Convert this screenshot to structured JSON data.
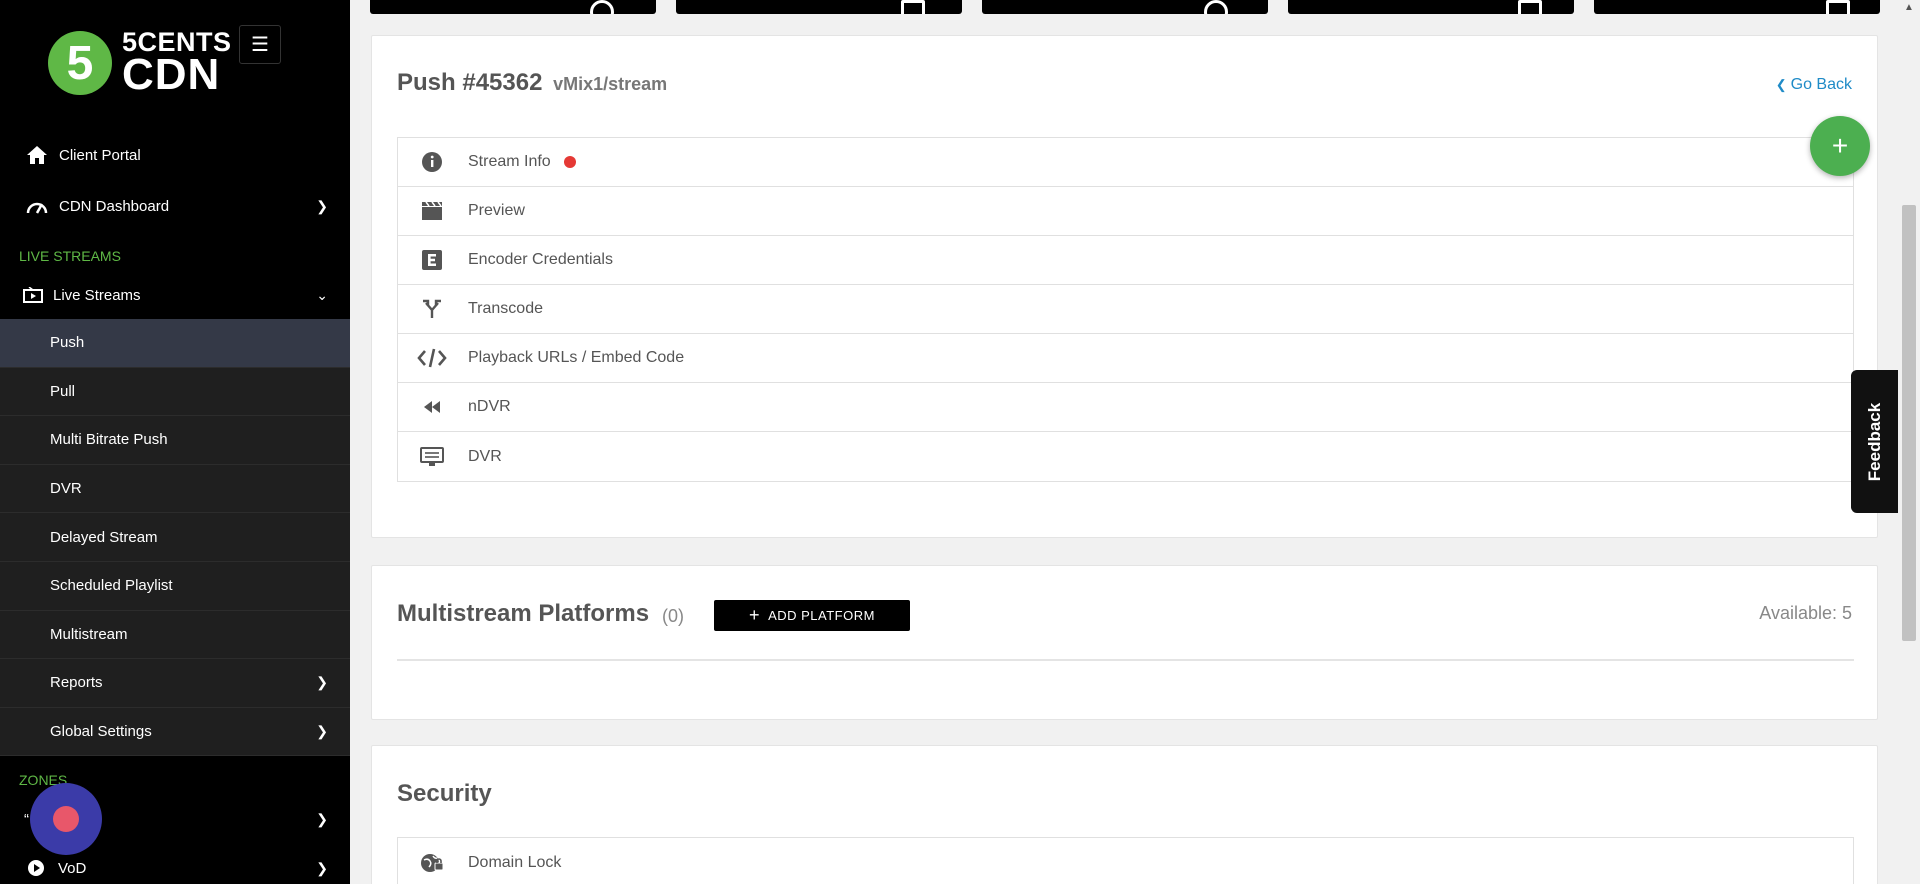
{
  "brand": {
    "logo_mark": "5",
    "logo_line1": "5CENTS",
    "logo_line2": "CDN",
    "accent_color": "#5fb846"
  },
  "sidebar": {
    "menu_icon": "hamburger-icon",
    "top_items": [
      {
        "label": "Client Portal",
        "icon": "home-icon"
      },
      {
        "label": "CDN Dashboard",
        "icon": "speedometer-icon"
      }
    ],
    "section_live": "LIVE STREAMS",
    "live_streams_label": "Live Streams",
    "sub_items": [
      {
        "label": "Push",
        "active": true
      },
      {
        "label": "Pull"
      },
      {
        "label": "Multi Bitrate Push"
      },
      {
        "label": "DVR"
      },
      {
        "label": "Delayed Stream"
      },
      {
        "label": "Scheduled Playlist"
      },
      {
        "label": "Multistream"
      },
      {
        "label": "Reports",
        "has_submenu": true
      },
      {
        "label": "Global Settings",
        "has_submenu": true
      }
    ],
    "section_zones": "ZONES",
    "zone_items": [
      {
        "label": "“"
      },
      {
        "label": "VoD",
        "icon": "play-circle-icon"
      }
    ]
  },
  "push": {
    "title": "Push #45362",
    "path": "vMix1/stream",
    "go_back": "Go Back",
    "items": [
      {
        "label": "Stream Info",
        "icon": "info-icon",
        "live_indicator": true
      },
      {
        "label": "Preview",
        "icon": "clapperboard-icon"
      },
      {
        "label": "Encoder Credentials",
        "icon": "encoder-e-icon"
      },
      {
        "label": "Transcode",
        "icon": "split-arrows-icon"
      },
      {
        "label": "Playback URLs / Embed Code",
        "icon": "code-icon"
      },
      {
        "label": "nDVR",
        "icon": "rewind-icon"
      },
      {
        "label": "DVR",
        "icon": "monitor-icon"
      }
    ],
    "fab_label": "+"
  },
  "multistream": {
    "title": "Multistream Platforms",
    "count": "(0)",
    "add_button": "ADD PLATFORM",
    "available": "Available: 5"
  },
  "security": {
    "title": "Security",
    "items": [
      {
        "label": "Domain Lock",
        "icon": "globe-lock-icon"
      }
    ]
  },
  "feedback": {
    "label": "Feedback"
  }
}
